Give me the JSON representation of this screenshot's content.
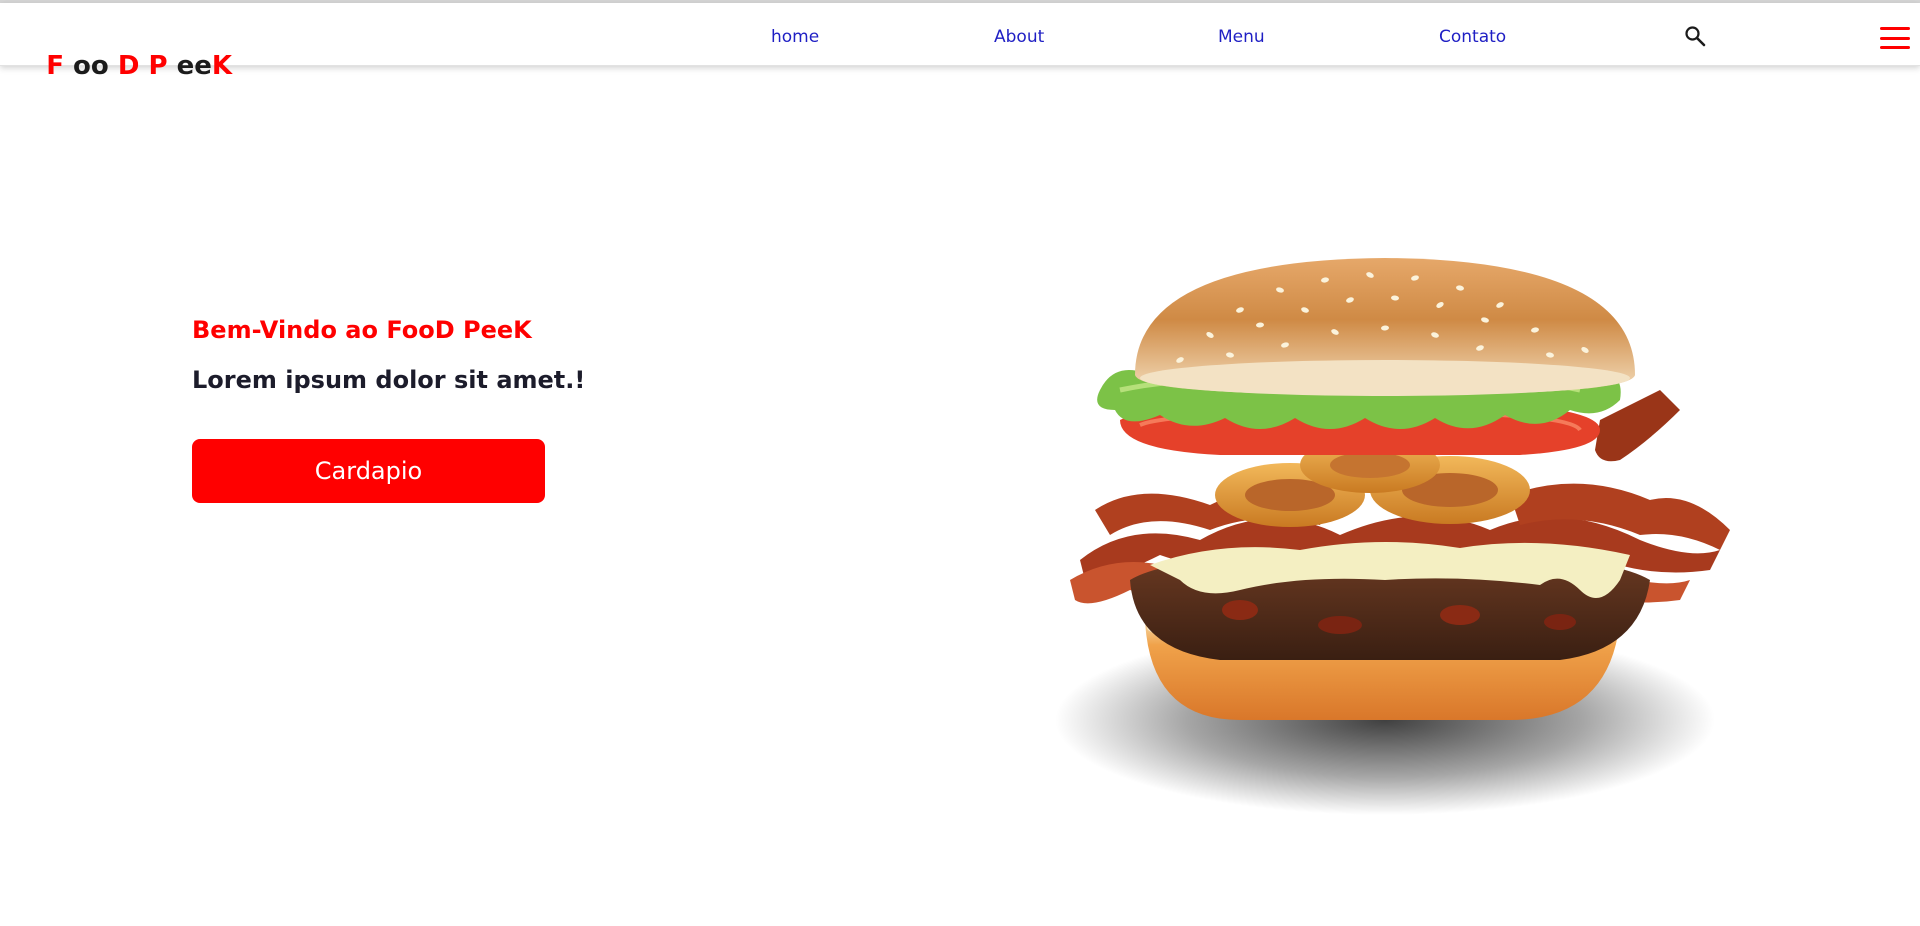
{
  "brand": {
    "logo_parts": [
      {
        "text": "F ",
        "color": "red"
      },
      {
        "text": "oo ",
        "color": "dark"
      },
      {
        "text": "D P ",
        "color": "red"
      },
      {
        "text": "ee",
        "color": "dark"
      },
      {
        "text": "K",
        "color": "red"
      }
    ]
  },
  "nav": {
    "links": [
      "home",
      "About",
      "Menu",
      "Contato"
    ]
  },
  "icons": {
    "search": "search-icon",
    "menu": "hamburger-menu-icon"
  },
  "hero": {
    "subtitle": "Bem-Vindo ao FooD PeeK",
    "title": "Lorem ipsum dolor sit amet.!",
    "button_label": "Cardapio",
    "image": "burger-image"
  },
  "colors": {
    "accent": "#ff0000",
    "nav_link": "#1f1fc4",
    "heading_dark": "#1c1c2b",
    "background": "#ffffff"
  }
}
